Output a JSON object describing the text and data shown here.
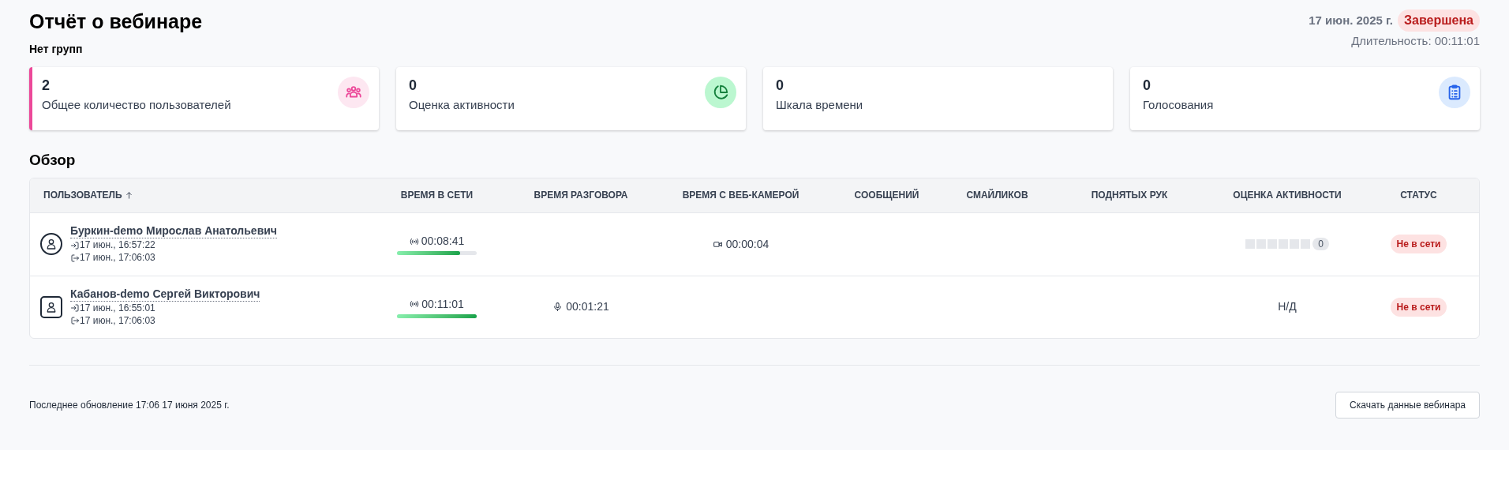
{
  "header": {
    "title": "Отчёт о вебинаре",
    "subtitle": "Нет групп",
    "date": "17 июн. 2025 г.",
    "status": "Завершена",
    "duration": "Длительность: 00:11:01"
  },
  "stats": [
    {
      "value": "2",
      "label": "Общее количество пользователей",
      "selected": true
    },
    {
      "value": "0",
      "label": "Оценка активности",
      "selected": false
    },
    {
      "value": "0",
      "label": "Шкала времени",
      "selected": false
    },
    {
      "value": "0",
      "label": "Голосования",
      "selected": false
    }
  ],
  "overview": {
    "title": "Обзор",
    "columns": [
      {
        "label": "ПОЛЬЗОВАТЕЛЬ"
      },
      {
        "label": "ВРЕМЯ В СЕТИ"
      },
      {
        "label": "ВРЕМЯ РАЗГОВОРА"
      },
      {
        "label": "ВРЕМЯ С ВЕБ-КАМЕРОЙ"
      },
      {
        "label": "СООБЩЕНИЙ"
      },
      {
        "label": "СМАЙЛИКОВ"
      },
      {
        "label": "ПОДНЯТЫХ РУК"
      },
      {
        "label": "ОЦЕНКА АКТИВНОСТИ"
      },
      {
        "label": "СТАТУС"
      }
    ],
    "rows": [
      {
        "name": "Буркин-demo Мирослав Анатольевич",
        "joined": "17 июн., 16:57:22",
        "left": "17 июн., 17:06:03",
        "online": {
          "time": "00:08:41",
          "level": 0.79
        },
        "camera": "00:00:04",
        "activity": {
          "kind": "meter",
          "count": "0"
        },
        "status": "Не в сети"
      },
      {
        "name": "Кабанов-demo Сергей Викторович",
        "joined": "17 июн., 16:55:01",
        "left": "17 июн., 17:06:03",
        "online": {
          "time": "00:11:01",
          "level": 1
        },
        "talk": "00:01:21",
        "activity": {
          "kind": "text",
          "text": "Н/Д"
        },
        "status": "Не в сети"
      }
    ]
  },
  "footer": {
    "updated": "Последнее обновление 17:06 17 июня 2025 г.",
    "download_button": "Скачать данные вебинара"
  }
}
